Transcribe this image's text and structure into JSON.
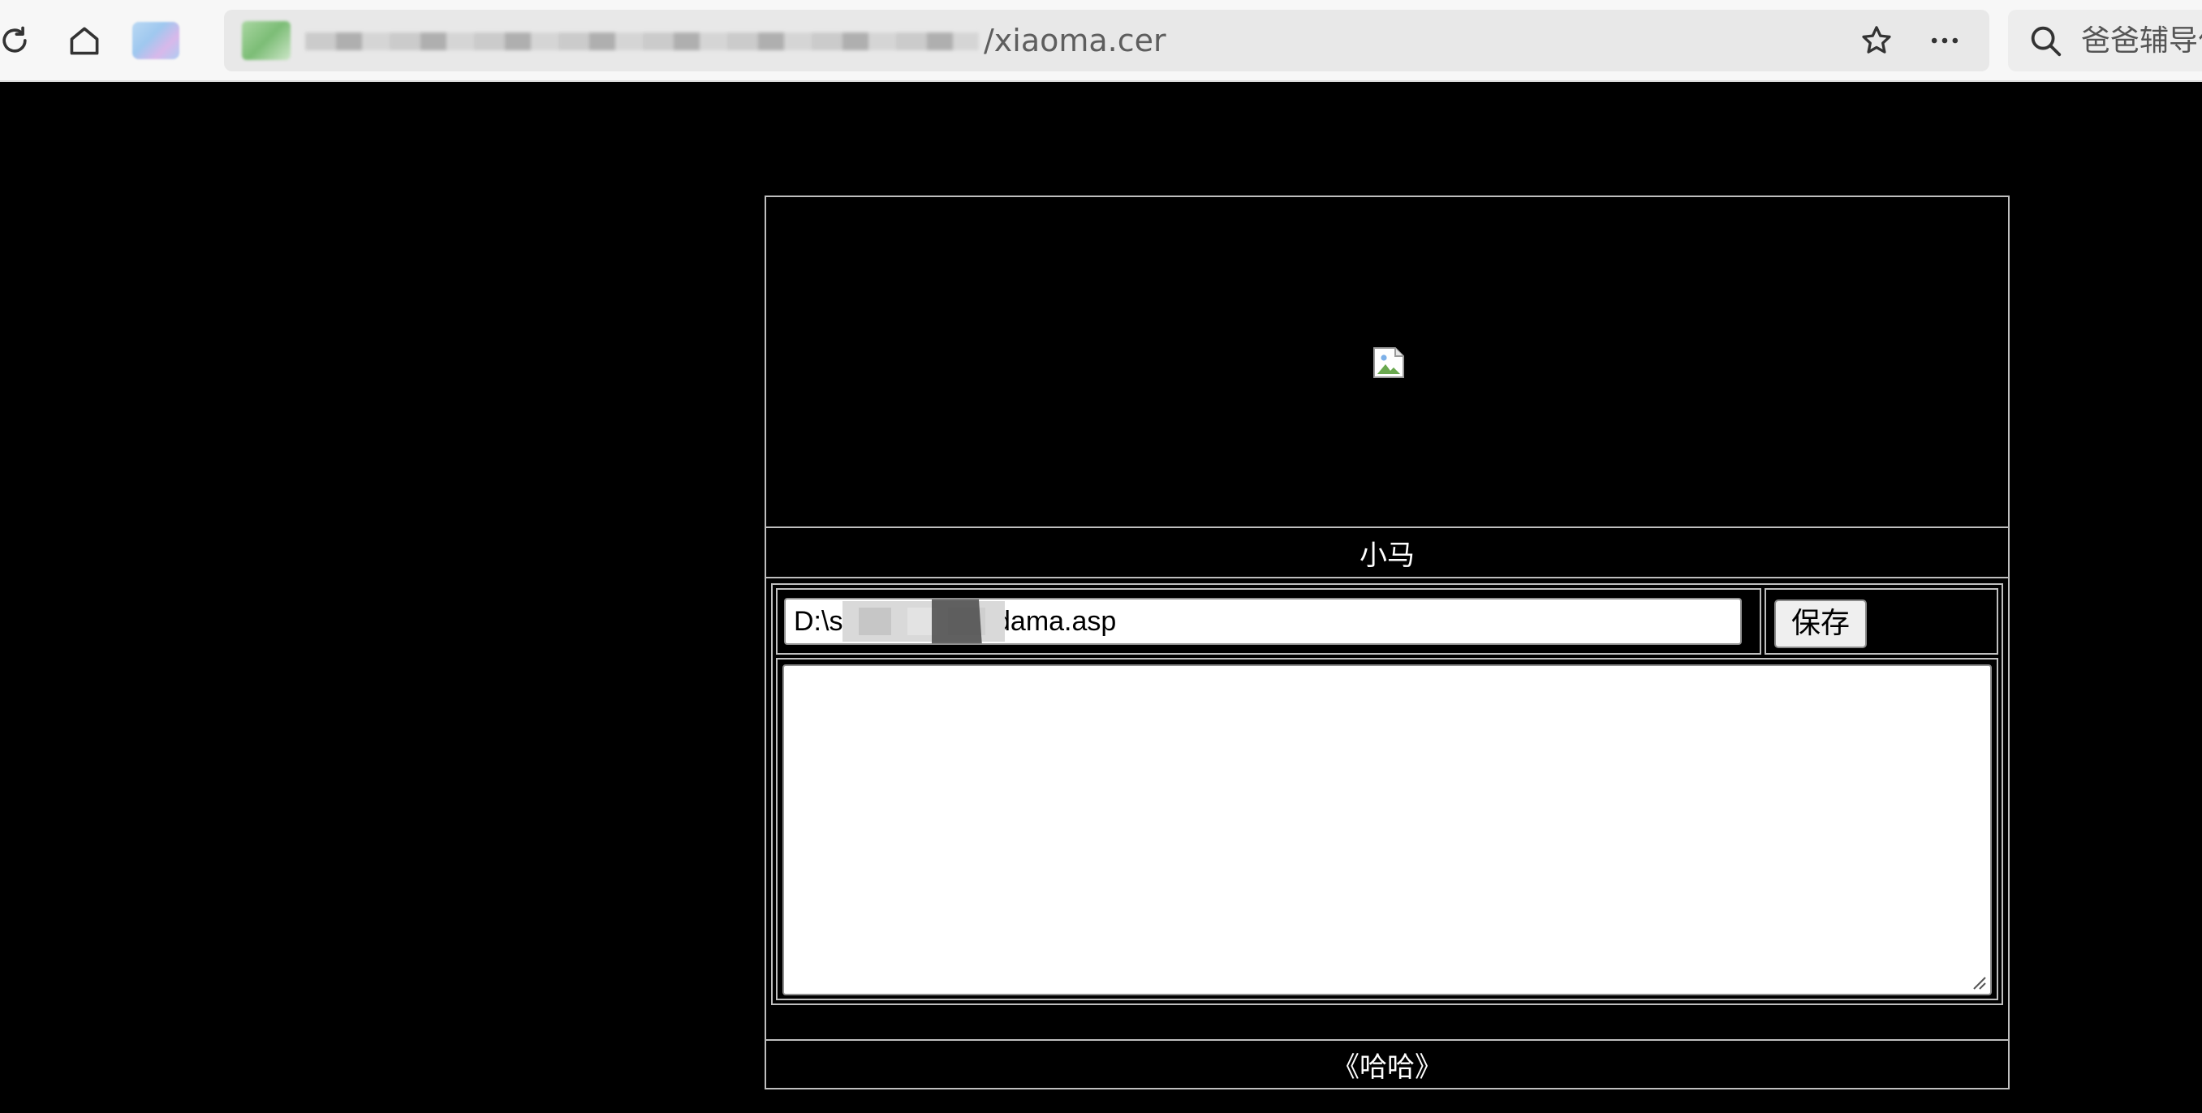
{
  "browser": {
    "address_bar": {
      "url_visible_suffix": "/xiaoma.cer"
    },
    "search_box": {
      "placeholder": "爸爸辅导作"
    },
    "icons": {
      "refresh": "refresh-icon",
      "home": "home-icon",
      "profile": "profile-icon",
      "site": "site-icon",
      "favorite": "star-icon",
      "more": "more-icon",
      "search": "search-icon"
    }
  },
  "page": {
    "background_color": "#000000",
    "border_color": "#bfbfbf",
    "header_image": {
      "state": "broken-image"
    },
    "title": "小马",
    "path_input": {
      "prefix": "D:\\s",
      "suffix": "dama.asp"
    },
    "save_button_label": "保存",
    "content_textarea_value": "",
    "footer_text": "《哈哈》"
  }
}
